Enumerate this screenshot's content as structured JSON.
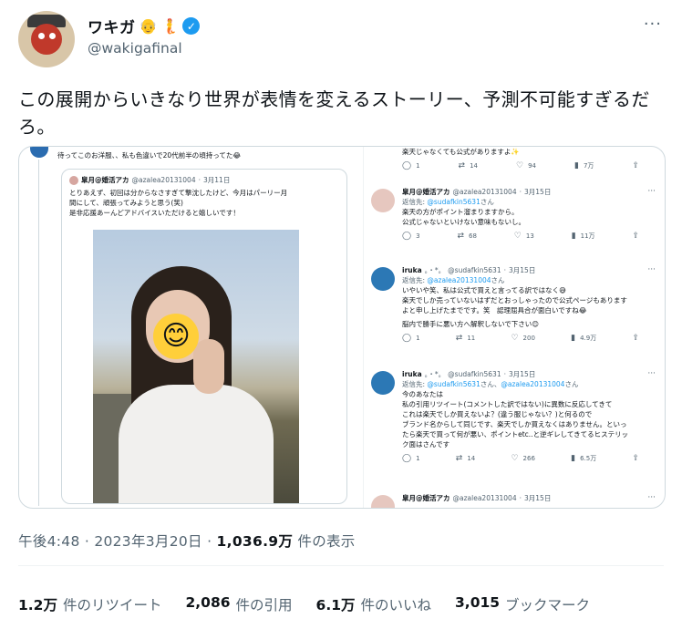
{
  "author": {
    "display_name": "ワキガ",
    "emojis": [
      "👴",
      "🧜"
    ],
    "handle": "@wakigafinal",
    "verified_color": "#1d9bf0"
  },
  "tweet_text": "この展開からいきなり世界が表情を変えるストーリー、予測不可能すぎるだろ。",
  "media": {
    "left": {
      "top_text": "待ってこのお洋服、、私も色違いで20代前半の頃持ってた😂",
      "quote": {
        "name": "皐月@婚活アカ",
        "handle": "@azalea20131004",
        "date": "3月11日",
        "lines": [
          "とりあえず、初回は分からなさすぎて撃沈したけど、今月はパーリー月",
          "間にして、頑張ってみようと思う(笑)",
          "是非応援あーんどアドバイスいただけると嬉しいです！"
        ],
        "photo_emoji": "😊"
      }
    },
    "right": {
      "top": {
        "line": "楽天じゃなくても公式がありますよ✨",
        "stats": [
          "1",
          "14",
          "94",
          "7万"
        ]
      },
      "replies": [
        {
          "name": "皐月@婚活アカ",
          "handle": "@azalea20131004",
          "date": "3月15日",
          "reply_to_label": "返信先:",
          "reply_to": "@sudafkin5631",
          "reply_to_suffix": "さん",
          "lines": [
            "楽天の方がポイント溜まりますから。",
            "公式じゃないといけない意味もないし。"
          ],
          "stats": [
            "3",
            "68",
            "13",
            "11万"
          ]
        },
        {
          "name": "iruka",
          "name_suffix": "。・*。",
          "handle": "@sudafkin5631",
          "date": "3月15日",
          "reply_to_label": "返信先:",
          "reply_to": "@azalea20131004",
          "reply_to_suffix": "さん",
          "lines": [
            "いやいや笑、私は公式で買えと言ってる訳ではなく😅",
            "楽天でしか売っていないはずだとおっしゃったので公式ページもあります",
            "よと申し上げたまでです。笑　認理屈具合が面白いですね😂",
            "",
            "脳内で勝手に悪い方へ解釈しないで下さい😊"
          ],
          "stats": [
            "1",
            "11",
            "200",
            "4.9万"
          ]
        },
        {
          "name": "iruka",
          "name_suffix": "。・*。",
          "handle": "@sudafkin5631",
          "date": "3月15日",
          "reply_to_label": "返信先:",
          "reply_to": "@sudafkin5631",
          "reply_to_mid": "さん、",
          "reply_to_2": "@azalea20131004",
          "reply_to_suffix": "さん",
          "lines": [
            "今のあなたは",
            "私の引用リツイート(コメントした訳ではない)に異数に反応してきて",
            "これは楽天でしか買えないよ？(違う服じゃない？)と何るので",
            "ブランド名からして同じです、楽天でしか買えなくはありません。といっ",
            "たら楽天で買って何が悪い、ポイントetc..と逆ギレしてきてるヒステリッ",
            "ク面はさんです"
          ],
          "stats": [
            "1",
            "14",
            "266",
            "6.5万"
          ]
        },
        {
          "name": "皐月@婚活アカ",
          "handle": "@azalea20131004",
          "date": "3月15日"
        }
      ]
    }
  },
  "meta": {
    "time": "午後4:48",
    "date": "2023年3月20日",
    "views": "1,036.9万",
    "views_label": "件の表示"
  },
  "stats": {
    "retweets": "1.2万",
    "retweets_label": "件のリツイート",
    "quotes": "2,086",
    "quotes_label": "件の引用",
    "likes": "6.1万",
    "likes_label": "件のいいね",
    "bookmarks": "3,015",
    "bookmarks_label": "ブックマーク"
  }
}
